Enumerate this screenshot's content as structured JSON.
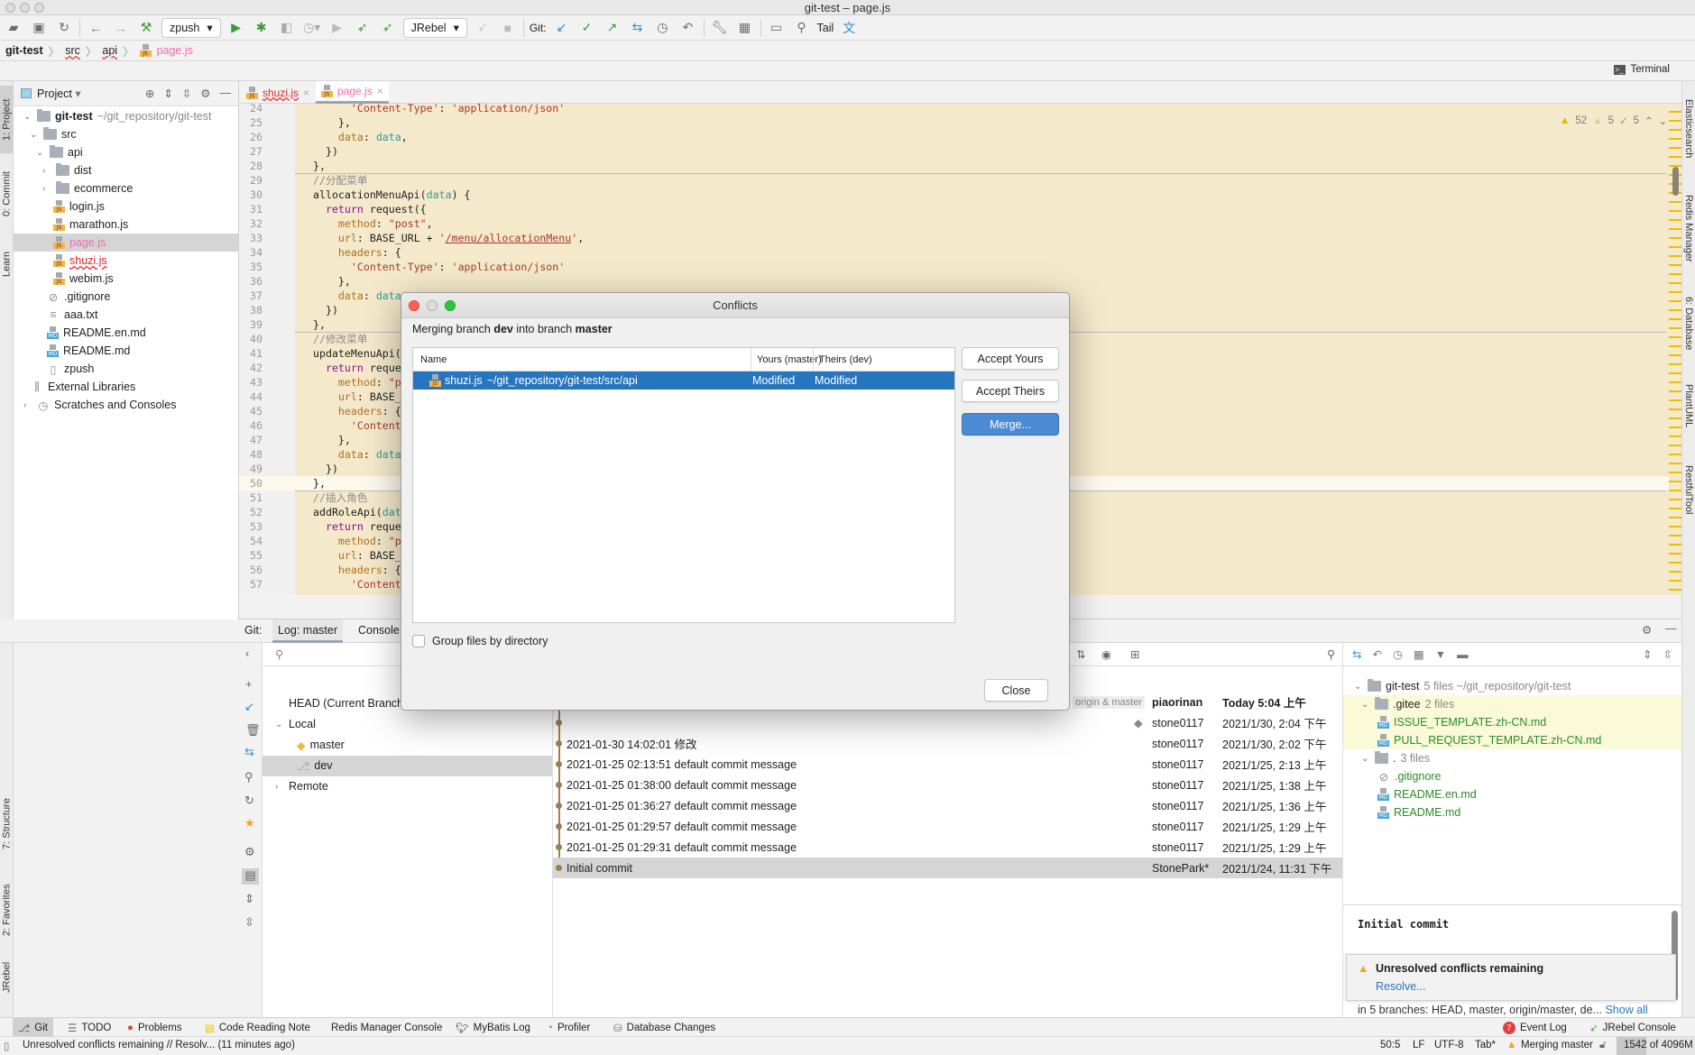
{
  "window": {
    "title": "git-test – page.js"
  },
  "toolbar": {
    "run_config": "zpush",
    "jrebel_config": "JRebel",
    "git_label": "Git:",
    "tail_label": "Tail",
    "icons": [
      "open-folder-icon",
      "save-icon",
      "sync-icon",
      "back-icon",
      "forward-icon",
      "build-icon",
      "run-icon",
      "debug-icon",
      "coverage-icon",
      "profile-icon",
      "jrebel-run-icon",
      "jrebel-debug-icon",
      "stop-icon",
      "git-update-icon",
      "git-commit-icon",
      "git-push-icon",
      "git-merge-icon",
      "history-icon",
      "rollback-icon",
      "settings-wrench-icon",
      "project-structure-icon",
      "search-icon",
      "translate-icon"
    ]
  },
  "breadcrumb": [
    "git-test",
    "src",
    "api",
    "page.js"
  ],
  "terminal_label": "Terminal",
  "left_stripe": [
    "1: Project",
    "0: Commit",
    "Learn",
    "7: Structure",
    "2: Favorites",
    "JRebel"
  ],
  "right_stripe": [
    "Elasticsearch",
    "Redis Manager",
    "6: Database",
    "PlantUML",
    "RestfulTool"
  ],
  "project": {
    "title": "Project",
    "tree": [
      {
        "label": "git-test",
        "extra": "~/git_repository/git-test",
        "type": "module",
        "depth": 0,
        "expanded": true,
        "bold": true
      },
      {
        "label": "src",
        "type": "folder",
        "depth": 1,
        "expanded": true
      },
      {
        "label": "api",
        "type": "folder",
        "depth": 2,
        "expanded": true
      },
      {
        "label": "dist",
        "type": "folder",
        "depth": 3,
        "expanded": false
      },
      {
        "label": "ecommerce",
        "type": "folder",
        "depth": 3,
        "expanded": false
      },
      {
        "label": "login.js",
        "type": "js",
        "depth": 3
      },
      {
        "label": "marathon.js",
        "type": "js",
        "depth": 3
      },
      {
        "label": "page.js",
        "type": "js",
        "depth": 3,
        "status": "modified",
        "selected": true
      },
      {
        "label": "shuzi.js",
        "type": "js",
        "depth": 3,
        "status": "conflict"
      },
      {
        "label": "webim.js",
        "type": "js",
        "depth": 3
      },
      {
        "label": ".gitignore",
        "type": "ignore",
        "depth": 2
      },
      {
        "label": "aaa.txt",
        "type": "txt",
        "depth": 2
      },
      {
        "label": "README.en.md",
        "type": "md",
        "depth": 2
      },
      {
        "label": "README.md",
        "type": "md",
        "depth": 2
      },
      {
        "label": "zpush",
        "type": "script",
        "depth": 2
      },
      {
        "label": "External Libraries",
        "type": "lib",
        "depth": 0
      },
      {
        "label": "Scratches and Consoles",
        "type": "scratch",
        "depth": 0,
        "expanded": false
      }
    ]
  },
  "editor": {
    "tabs": [
      {
        "label": "shuzi.js",
        "status": "conflict"
      },
      {
        "label": "page.js",
        "status": "modified",
        "active": true
      }
    ],
    "inspections": {
      "warnings": "52",
      "weak_warnings": "5",
      "typos": "5"
    },
    "current_line": 50,
    "lines": [
      {
        "n": "24",
        "tokens": [
          [
            "p",
            "      "
          ],
          [
            "s",
            "'Content-Type'"
          ],
          [
            "p",
            ": "
          ],
          [
            "s",
            "'application/json'"
          ]
        ]
      },
      {
        "n": "25",
        "tokens": [
          [
            "p",
            "    },"
          ]
        ]
      },
      {
        "n": "26",
        "tokens": [
          [
            "p",
            "    "
          ],
          [
            "k",
            "data"
          ],
          [
            "p",
            ": "
          ],
          [
            "v",
            "data"
          ],
          [
            "p",
            ","
          ]
        ]
      },
      {
        "n": "27",
        "tokens": [
          [
            "p",
            "  })"
          ]
        ]
      },
      {
        "n": "28",
        "tokens": [
          [
            "p",
            "},"
          ]
        ]
      },
      {
        "n": "29",
        "tokens": [
          [
            "c",
            "//分配菜单"
          ]
        ]
      },
      {
        "n": "30",
        "tokens": [
          [
            "p",
            "allocationMenuApi("
          ],
          [
            "v",
            "data"
          ],
          [
            "p",
            ") {"
          ]
        ]
      },
      {
        "n": "31",
        "tokens": [
          [
            "p",
            "  "
          ],
          [
            "r",
            "return"
          ],
          [
            "p",
            " request({"
          ]
        ]
      },
      {
        "n": "32",
        "tokens": [
          [
            "p",
            "    "
          ],
          [
            "k",
            "method"
          ],
          [
            "p",
            ": "
          ],
          [
            "s",
            "\"post\""
          ],
          [
            "p",
            ","
          ]
        ]
      },
      {
        "n": "33",
        "tokens": [
          [
            "p",
            "    "
          ],
          [
            "k",
            "url"
          ],
          [
            "p",
            ": BASE_URL + "
          ],
          [
            "s",
            "'"
          ],
          [
            "u",
            "/menu/allocationMenu"
          ],
          [
            "s",
            "'"
          ],
          [
            "p",
            ","
          ]
        ]
      },
      {
        "n": "34",
        "tokens": [
          [
            "p",
            "    "
          ],
          [
            "k",
            "headers"
          ],
          [
            "p",
            ": {"
          ]
        ]
      },
      {
        "n": "35",
        "tokens": [
          [
            "p",
            "      "
          ],
          [
            "s",
            "'Content-Type'"
          ],
          [
            "p",
            ": "
          ],
          [
            "s",
            "'application/json'"
          ]
        ]
      },
      {
        "n": "36",
        "tokens": [
          [
            "p",
            "    },"
          ]
        ]
      },
      {
        "n": "37",
        "tokens": [
          [
            "p",
            "    "
          ],
          [
            "k",
            "data"
          ],
          [
            "p",
            ": "
          ],
          [
            "v",
            "data"
          ]
        ]
      },
      {
        "n": "38",
        "tokens": [
          [
            "p",
            "  })"
          ]
        ]
      },
      {
        "n": "39",
        "tokens": [
          [
            "p",
            "},"
          ]
        ]
      },
      {
        "n": "40",
        "tokens": [
          [
            "c",
            "//修改菜单"
          ]
        ]
      },
      {
        "n": "41",
        "tokens": [
          [
            "p",
            "updateMenuApi("
          ]
        ]
      },
      {
        "n": "42",
        "tokens": [
          [
            "p",
            "  "
          ],
          [
            "r",
            "return"
          ],
          [
            "p",
            " reque"
          ]
        ]
      },
      {
        "n": "43",
        "tokens": [
          [
            "p",
            "    "
          ],
          [
            "k",
            "method"
          ],
          [
            "p",
            ": "
          ],
          [
            "s",
            "\"p"
          ]
        ]
      },
      {
        "n": "44",
        "tokens": [
          [
            "p",
            "    "
          ],
          [
            "k",
            "url"
          ],
          [
            "p",
            ": BASE_"
          ]
        ]
      },
      {
        "n": "45",
        "tokens": [
          [
            "p",
            "    "
          ],
          [
            "k",
            "headers"
          ],
          [
            "p",
            ": {"
          ]
        ]
      },
      {
        "n": "46",
        "tokens": [
          [
            "p",
            "      "
          ],
          [
            "s",
            "'Content"
          ]
        ]
      },
      {
        "n": "47",
        "tokens": [
          [
            "p",
            "    },"
          ]
        ]
      },
      {
        "n": "48",
        "tokens": [
          [
            "p",
            "    "
          ],
          [
            "k",
            "data"
          ],
          [
            "p",
            ": "
          ],
          [
            "v",
            "data"
          ]
        ]
      },
      {
        "n": "49",
        "tokens": [
          [
            "p",
            "  })"
          ]
        ]
      },
      {
        "n": "50",
        "tokens": [
          [
            "p",
            "},"
          ]
        ]
      },
      {
        "n": "51",
        "tokens": [
          [
            "c",
            "//插入角色"
          ]
        ]
      },
      {
        "n": "52",
        "tokens": [
          [
            "p",
            "addRoleApi("
          ],
          [
            "v",
            "dat"
          ]
        ]
      },
      {
        "n": "53",
        "tokens": [
          [
            "p",
            "  "
          ],
          [
            "r",
            "return"
          ],
          [
            "p",
            " reque"
          ]
        ]
      },
      {
        "n": "54",
        "tokens": [
          [
            "p",
            "    "
          ],
          [
            "k",
            "method"
          ],
          [
            "p",
            ": "
          ],
          [
            "s",
            "\"p"
          ]
        ]
      },
      {
        "n": "55",
        "tokens": [
          [
            "p",
            "    "
          ],
          [
            "k",
            "url"
          ],
          [
            "p",
            ": BASE_"
          ]
        ]
      },
      {
        "n": "56",
        "tokens": [
          [
            "p",
            "    "
          ],
          [
            "k",
            "headers"
          ],
          [
            "p",
            ": {"
          ]
        ]
      },
      {
        "n": "57",
        "tokens": [
          [
            "p",
            "      "
          ],
          [
            "s",
            "'Content"
          ]
        ]
      }
    ]
  },
  "git": {
    "label": "Git:",
    "tabs": [
      "Log: master",
      "Console"
    ],
    "branches": [
      {
        "label": "HEAD (Current Branch",
        "depth": 0
      },
      {
        "label": "Local",
        "depth": 0,
        "expanded": true
      },
      {
        "label": "master",
        "depth": 1,
        "icon": "tag"
      },
      {
        "label": "dev",
        "depth": 1,
        "icon": "branch",
        "selected": true
      },
      {
        "label": "Remote",
        "depth": 0,
        "expanded": false
      }
    ],
    "log": [
      {
        "message": "",
        "refs": "origin & master",
        "author": "piaorinan",
        "date": "Today 5:04 上午",
        "bold": true
      },
      {
        "message": "",
        "tag": true,
        "author": "stone0117",
        "date": "2021/1/30, 2:04 下午"
      },
      {
        "message": "2021-01-30 14:02:01 修改",
        "author": "stone0117",
        "date": "2021/1/30, 2:02 下午"
      },
      {
        "message": "2021-01-25 02:13:51 default commit message",
        "author": "stone0117",
        "date": "2021/1/25, 2:13 上午"
      },
      {
        "message": "2021-01-25 01:38:00 default commit message",
        "author": "stone0117",
        "date": "2021/1/25, 1:38 上午"
      },
      {
        "message": "2021-01-25 01:36:27 default commit message",
        "author": "stone0117",
        "date": "2021/1/25, 1:36 上午"
      },
      {
        "message": "2021-01-25 01:29:57 default commit message",
        "author": "stone0117",
        "date": "2021/1/25, 1:29 上午"
      },
      {
        "message": "2021-01-25 01:29:31 default commit message",
        "author": "stone0117",
        "date": "2021/1/25, 1:29 上午"
      },
      {
        "message": "Initial commit",
        "author": "StonePark*",
        "date": "2021/1/24, 11:31 下午",
        "selected": true
      }
    ],
    "changes": [
      {
        "label": "git-test",
        "extra": "5 files ~/git_repository/git-test",
        "type": "module",
        "depth": 0
      },
      {
        "label": ".gitee",
        "extra": "2 files",
        "type": "folder",
        "depth": 1,
        "highlight": true
      },
      {
        "label": "ISSUE_TEMPLATE.zh-CN.md",
        "type": "md",
        "depth": 2,
        "highlight": true
      },
      {
        "label": "PULL_REQUEST_TEMPLATE.zh-CN.md",
        "type": "md",
        "depth": 2,
        "highlight": true
      },
      {
        "label": ".",
        "extra": "3 files",
        "type": "folder",
        "depth": 1
      },
      {
        "label": ".gitignore",
        "type": "ignore",
        "depth": 2
      },
      {
        "label": "README.en.md",
        "type": "md",
        "depth": 2
      },
      {
        "label": "README.md",
        "type": "md",
        "depth": 2
      }
    ],
    "details": {
      "subject": "Initial commit",
      "branches_line": "in 5 branches: HEAD, master, origin/master, de...",
      "show_all": "Show all"
    }
  },
  "notification": {
    "title": "Unresolved conflicts remaining",
    "action": "Resolve..."
  },
  "dialog": {
    "title": "Conflicts",
    "message_parts": [
      "Merging branch ",
      "dev",
      " into branch ",
      "master"
    ],
    "columns": [
      "Name",
      "Yours (master)",
      "Theirs (dev)"
    ],
    "rows": [
      {
        "file": "shuzi.js",
        "path": "~/git_repository/git-test/src/api",
        "yours": "Modified",
        "theirs": "Modified"
      }
    ],
    "buttons": {
      "accept_yours": "Accept Yours",
      "accept_theirs": "Accept Theirs",
      "merge": "Merge...",
      "close": "Close"
    },
    "group_by_directory": {
      "label": "Group files by directory",
      "checked": false
    }
  },
  "bottom_tabs": [
    "Git",
    "TODO",
    "Problems",
    "Code Reading Note",
    "Redis Manager Console",
    "MyBatis Log",
    "Profiler",
    "Database Changes"
  ],
  "bottom_right_tabs": {
    "event_log": "Event Log",
    "event_count": "7",
    "jrebel": "JRebel Console"
  },
  "status": {
    "message": "Unresolved conflicts remaining // Resolv... (11 minutes ago)",
    "position": "50:5",
    "line_sep": "LF",
    "encoding": "UTF-8",
    "indent": "Tab*",
    "vcs": "Merging master",
    "memory": "1542 of 4096M",
    "memory_used_fraction": 0.376
  },
  "colors": {
    "accent": "#2675bf",
    "conflict": "#e02424",
    "modified": "#f06bb0",
    "added": "#2a8c2a",
    "merge_bg": "#f5e9cb"
  }
}
